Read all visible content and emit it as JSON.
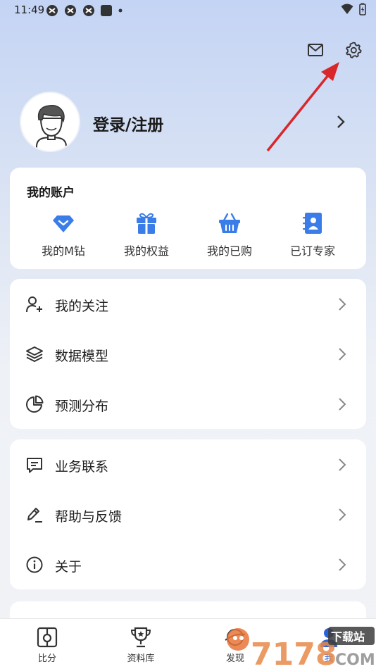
{
  "status_bar": {
    "time": "11:49",
    "icons": [
      "app-notification-icon",
      "app-notification-icon",
      "app-notification-icon",
      "square-notification-icon",
      "dot-icon"
    ],
    "right_icons": [
      "wifi-icon",
      "battery-icon"
    ]
  },
  "header": {
    "icons": [
      "mail-icon",
      "gear-icon"
    ]
  },
  "profile": {
    "login_label": "登录/注册"
  },
  "account": {
    "title": "我的账户",
    "items": [
      {
        "label": "我的M钻",
        "icon": "diamond-icon"
      },
      {
        "label": "我的权益",
        "icon": "gift-icon"
      },
      {
        "label": "我的已购",
        "icon": "basket-icon"
      },
      {
        "label": "已订专家",
        "icon": "contact-book-icon"
      }
    ]
  },
  "menu_group_1": [
    {
      "label": "我的关注",
      "icon": "follow-user-icon"
    },
    {
      "label": "数据模型",
      "icon": "layers-icon"
    },
    {
      "label": "预测分布",
      "icon": "pie-chart-icon"
    }
  ],
  "menu_group_2": [
    {
      "label": "业务联系",
      "icon": "message-icon"
    },
    {
      "label": "帮助与反馈",
      "icon": "pen-feedback-icon"
    },
    {
      "label": "关于",
      "icon": "info-icon"
    }
  ],
  "bottom_nav": [
    {
      "label": "比分",
      "icon": "score-icon"
    },
    {
      "label": "资料库",
      "icon": "trophy-icon"
    },
    {
      "label": "发现",
      "icon": "discover-icon"
    },
    {
      "label": "我",
      "icon": "user-icon"
    }
  ],
  "watermark": {
    "text": "7178",
    "subtext": "下载站",
    "domain": "COM"
  },
  "colors": {
    "accent": "#2a63d8",
    "icon_blue": "#3b7de8",
    "annotation_red": "#d9262b"
  }
}
